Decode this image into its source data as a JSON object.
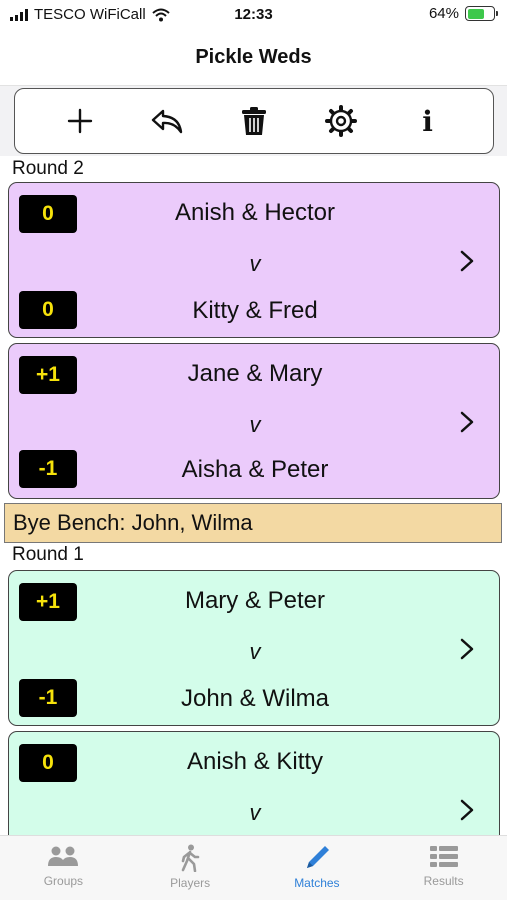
{
  "status_bar": {
    "carrier": "TESCO WiFiCall",
    "time": "12:33",
    "battery_percent": "64%",
    "battery_level": 0.64
  },
  "nav": {
    "title": "Pickle Weds"
  },
  "toolbar": {
    "buttons": [
      {
        "name": "add",
        "icon": "plus-icon"
      },
      {
        "name": "undo",
        "icon": "undo-icon"
      },
      {
        "name": "delete",
        "icon": "trash-icon"
      },
      {
        "name": "settings",
        "icon": "gear-icon"
      },
      {
        "name": "info",
        "icon": "info-icon",
        "glyph": "i"
      }
    ]
  },
  "rounds": [
    {
      "label": "Round 2",
      "color": "#ebcbfb",
      "matches": [
        {
          "team1": "Anish & Hector",
          "score1": "0",
          "vs": "v",
          "team2": "Kitty & Fred",
          "score2": "0"
        },
        {
          "team1": "Jane & Mary",
          "score1": "+1",
          "vs": "v",
          "team2": "Aisha & Peter",
          "score2": "-1"
        }
      ],
      "bye_bench": "Bye Bench: John, Wilma"
    },
    {
      "label": "Round 1",
      "color": "#d3fdea",
      "matches": [
        {
          "team1": "Mary & Peter",
          "score1": "+1",
          "vs": "v",
          "team2": "John & Wilma",
          "score2": "-1"
        },
        {
          "team1": "Anish & Kitty",
          "score1": "0",
          "vs": "v"
        }
      ]
    }
  ],
  "tab_bar": {
    "active": "Matches",
    "active_color": "#2f80d8",
    "inactive_color": "#9a9a9a",
    "tabs": [
      {
        "label": "Groups",
        "icon": "group-icon"
      },
      {
        "label": "Players",
        "icon": "walking-person-icon"
      },
      {
        "label": "Matches",
        "icon": "pencil-icon"
      },
      {
        "label": "Results",
        "icon": "list-icon"
      }
    ]
  }
}
